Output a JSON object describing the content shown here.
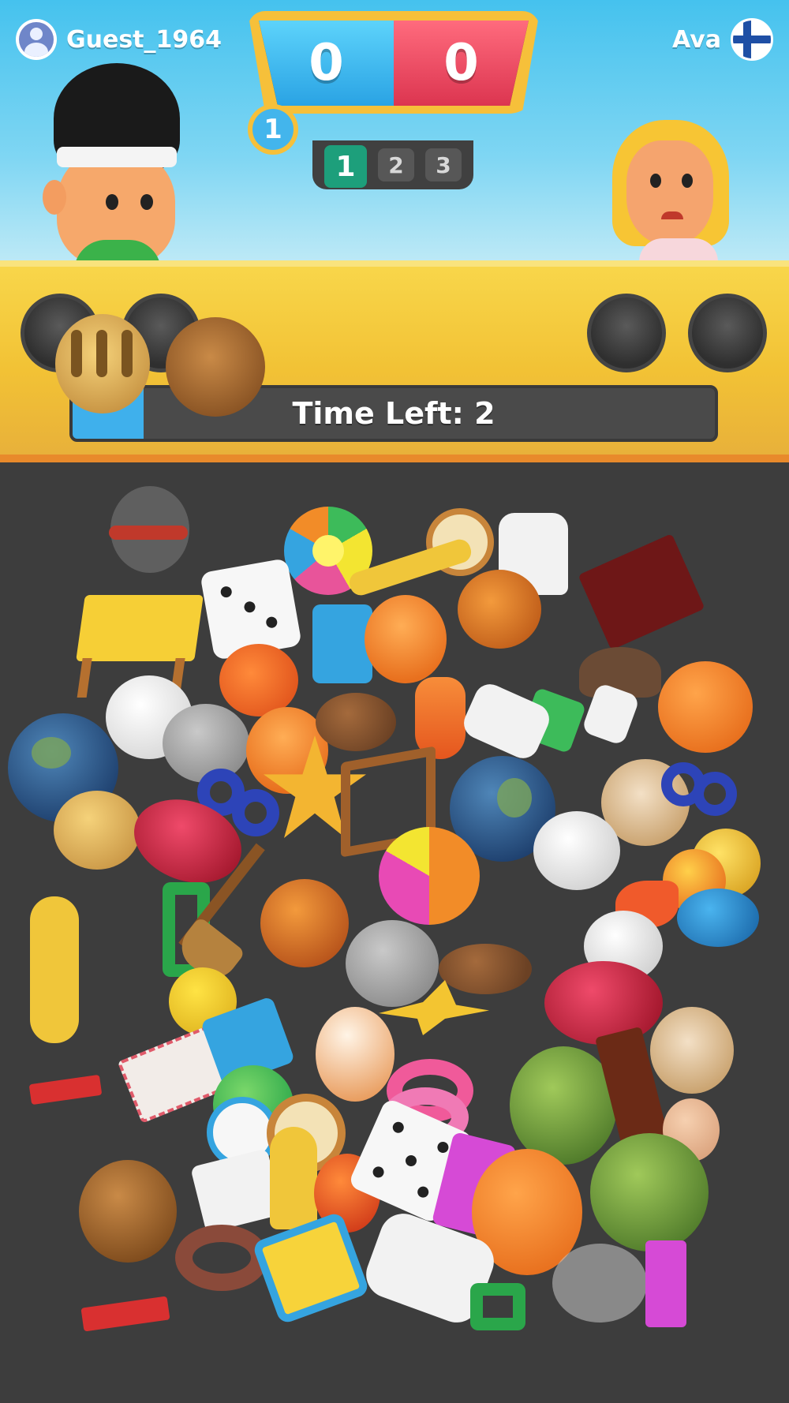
{
  "players": {
    "left": {
      "name": "Guest_1964",
      "score": "0"
    },
    "right": {
      "name": "Ava",
      "score": "0",
      "flag": "finland-flag"
    }
  },
  "round": {
    "current_badge": "1",
    "pills": [
      "1",
      "2",
      "3"
    ],
    "active_index": 0
  },
  "tray": {
    "timer_label": "Time Left: 2",
    "timer_fill_fraction": 0.11,
    "slots_total": 4
  },
  "colors": {
    "blue_team": "#2aa3e4",
    "red_team": "#dc3550",
    "tray_yellow": "#f2c235",
    "round_active": "#1d9f7b"
  },
  "items": [
    {
      "name": "dragonfly-item"
    },
    {
      "name": "beach-ball-item"
    },
    {
      "name": "tambourine-item"
    },
    {
      "name": "chef-hat-item"
    },
    {
      "name": "dice-item"
    },
    {
      "name": "book-item"
    },
    {
      "name": "table-item"
    },
    {
      "name": "trumpet-item"
    },
    {
      "name": "tiger-ball-item"
    },
    {
      "name": "onion-item"
    },
    {
      "name": "pumpkin-item"
    },
    {
      "name": "earth-globe-item"
    },
    {
      "name": "mushroom-item"
    },
    {
      "name": "star-item"
    },
    {
      "name": "number-8-item"
    },
    {
      "name": "sweet-potato-item"
    },
    {
      "name": "broom-item"
    },
    {
      "name": "clam-shell-item"
    },
    {
      "name": "goldfish-item"
    },
    {
      "name": "letter-r-item"
    }
  ]
}
